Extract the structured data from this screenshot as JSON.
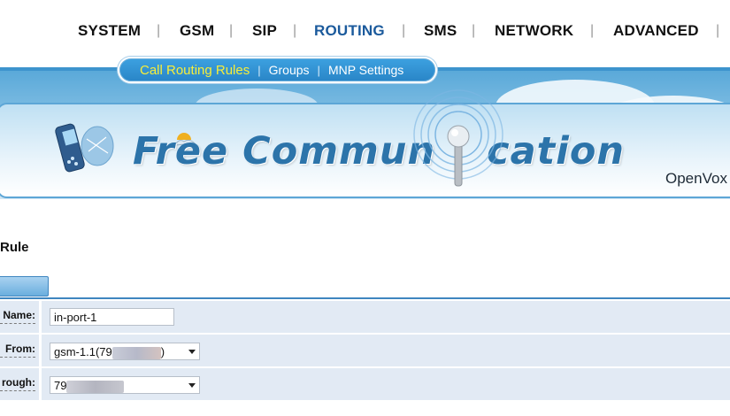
{
  "nav": {
    "items": [
      {
        "label": "SYSTEM",
        "active": false
      },
      {
        "label": "GSM",
        "active": false
      },
      {
        "label": "SIP",
        "active": false
      },
      {
        "label": "ROUTING",
        "active": true
      },
      {
        "label": "SMS",
        "active": false
      },
      {
        "label": "NETWORK",
        "active": false
      },
      {
        "label": "ADVANCED",
        "active": false
      }
    ],
    "separator": "|"
  },
  "subnav": {
    "items": [
      {
        "label": "Call Routing Rules",
        "active": true
      },
      {
        "label": "Groups",
        "active": false
      },
      {
        "label": "MNP Settings",
        "active": false
      }
    ],
    "separator": "|"
  },
  "banner": {
    "title_part1": "Free Commun",
    "title_part2": "cation",
    "brand": "OpenVox"
  },
  "page": {
    "title": "Rule"
  },
  "form": {
    "rows": [
      {
        "label": "Name:",
        "value": "in-port-1"
      },
      {
        "label": "From:",
        "value": "gsm-1.1(79",
        "suffix": ")"
      },
      {
        "label": "rough:",
        "value": "79"
      }
    ]
  },
  "colors": {
    "accent": "#3d93cd",
    "active_nav": "#1b5a9c",
    "active_subtab": "#f8ee38",
    "row_bg": "#e2eaf4"
  }
}
